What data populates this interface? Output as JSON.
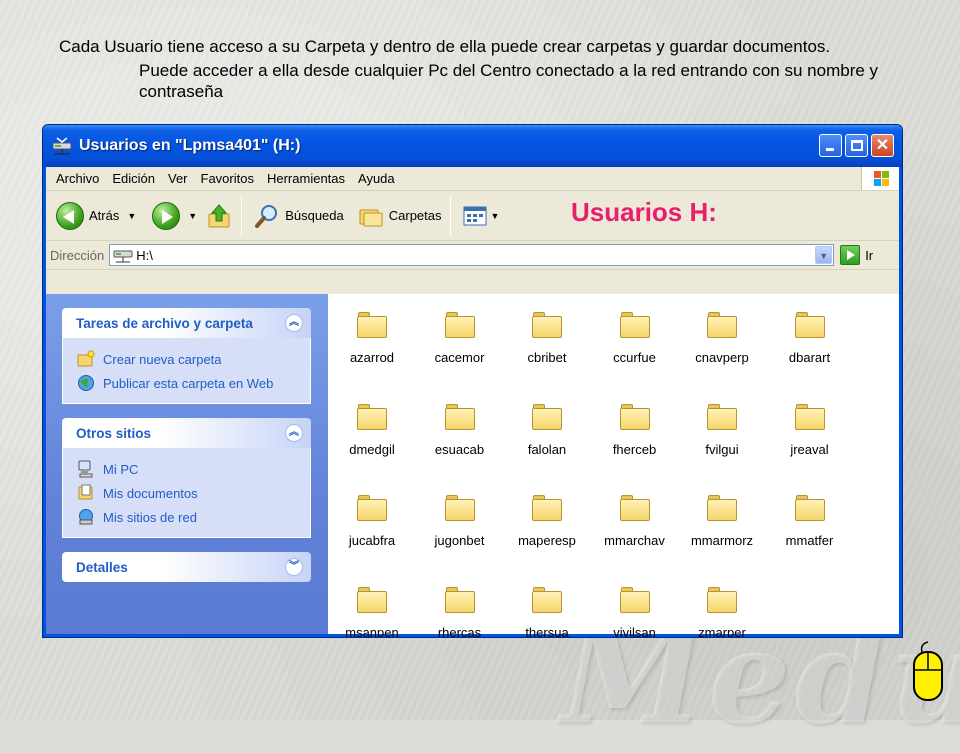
{
  "caption": {
    "line1": "Cada Usuario tiene acceso a su Carpeta y dentro de ella puede crear carpetas y guardar documentos.",
    "line2": "Puede acceder a ella desde cualquier Pc del Centro conectado a la red entrando con su nombre y contraseña"
  },
  "window": {
    "title": "Usuarios en \"Lpmsa401\" (H:)"
  },
  "menu": [
    "Archivo",
    "Edición",
    "Ver",
    "Favoritos",
    "Herramientas",
    "Ayuda"
  ],
  "toolbar": {
    "back_label": "Atrás",
    "search_label": "Búsqueda",
    "folders_label": "Carpetas",
    "banner": "Usuarios  H:"
  },
  "address": {
    "label": "Dirección",
    "value": "H:\\",
    "go_label": "Ir"
  },
  "taskpane": {
    "file_tasks": {
      "title": "Tareas de archivo y carpeta",
      "items": [
        "Crear nueva carpeta",
        "Publicar esta carpeta en Web"
      ]
    },
    "other_places": {
      "title": "Otros sitios",
      "items": [
        "Mi PC",
        "Mis documentos",
        "Mis sitios de red"
      ]
    },
    "details": {
      "title": "Detalles"
    }
  },
  "folders": [
    "azarrod",
    "cacemor",
    "cbribet",
    "ccurfue",
    "cnavperp",
    "dbarart",
    "dmedgil",
    "esuacab",
    "falolan",
    "fherceb",
    "fvilgui",
    "jreaval",
    "jucabfra",
    "jugonbet",
    "maperesp",
    "mmarchav",
    "mmarmorz",
    "mmatfer",
    "msanpen",
    "rhercas",
    "thersua",
    "vivilsan",
    "zmarper"
  ],
  "colors": {
    "titlebar": "#0455e2",
    "taskpane": "#6283d8",
    "link": "#215dc6",
    "banner": "#ec1c6c"
  }
}
